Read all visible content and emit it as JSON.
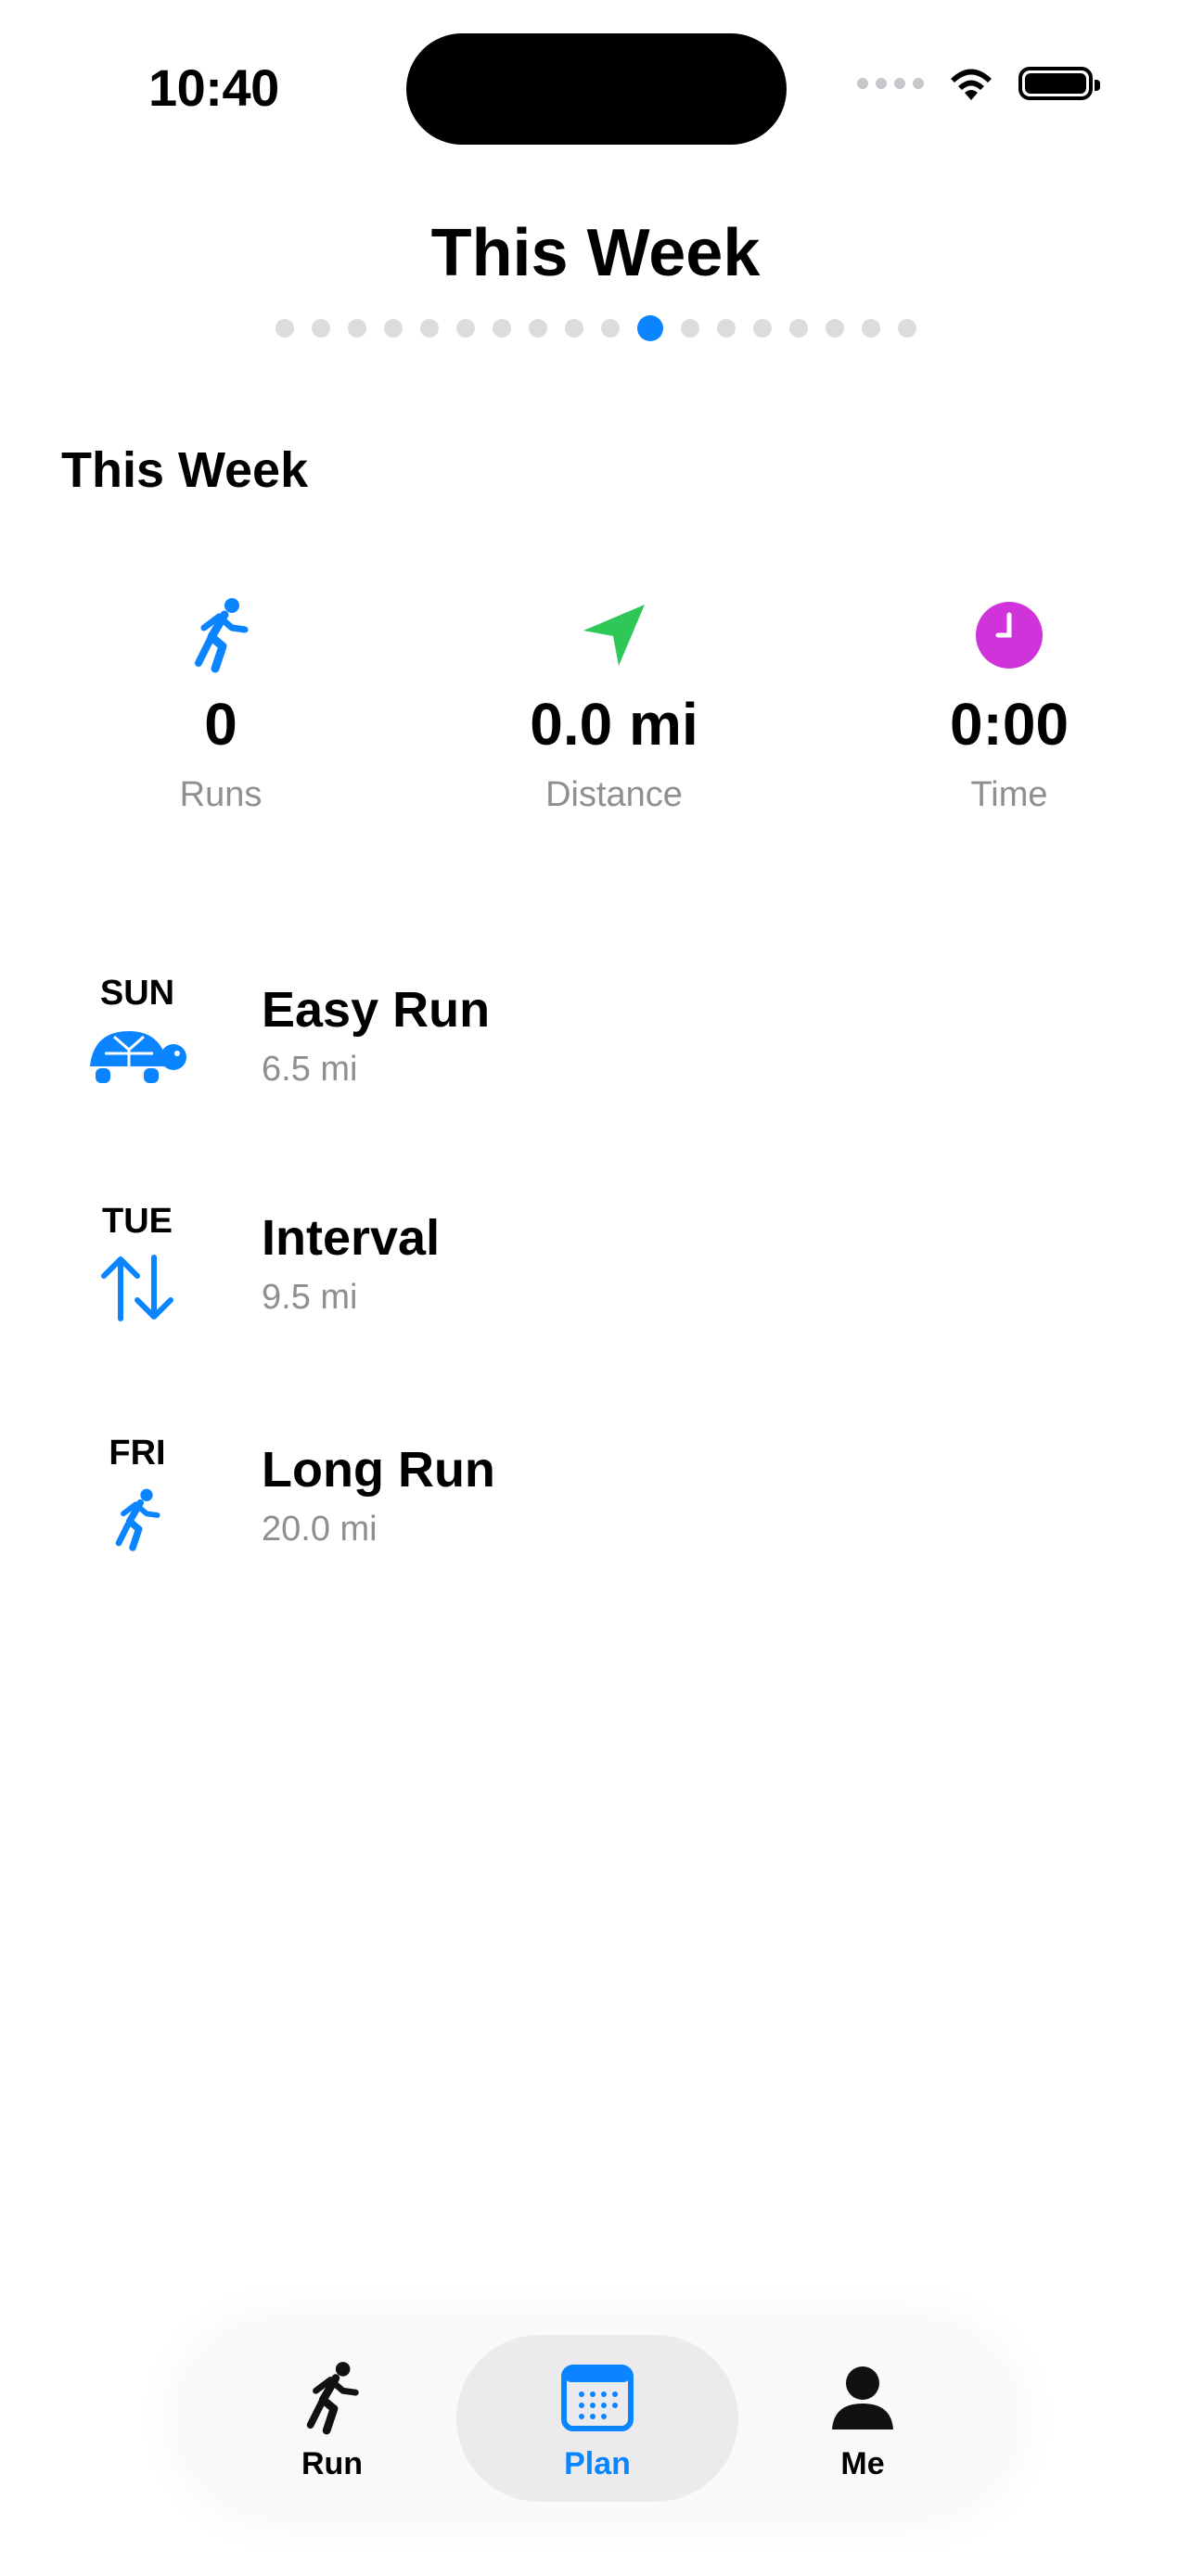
{
  "status_bar": {
    "time": "10:40"
  },
  "header": {
    "title": "This Week",
    "page_count": 18,
    "active_page_index": 10
  },
  "section": {
    "title": "This Week"
  },
  "stats": [
    {
      "icon": "running-figure-icon",
      "value": "0",
      "label": "Runs",
      "color": "#0a84ff"
    },
    {
      "icon": "location-arrow-icon",
      "value": "0.0 mi",
      "label": "Distance",
      "color": "#30c759"
    },
    {
      "icon": "clock-icon",
      "value": "0:00",
      "label": "Time",
      "color": "#d033d9"
    }
  ],
  "workouts": [
    {
      "day": "SUN",
      "icon": "tortoise-icon",
      "name": "Easy Run",
      "distance": "6.5 mi"
    },
    {
      "day": "TUE",
      "icon": "up-down-arrows-icon",
      "name": "Interval",
      "distance": "9.5 mi"
    },
    {
      "day": "FRI",
      "icon": "running-figure-icon",
      "name": "Long Run",
      "distance": "20.0 mi"
    }
  ],
  "tabbar": {
    "tabs": [
      {
        "label": "Run",
        "icon": "running-figure-icon",
        "active": false
      },
      {
        "label": "Plan",
        "icon": "calendar-icon",
        "active": true
      },
      {
        "label": "Me",
        "icon": "person-icon",
        "active": false
      }
    ]
  },
  "colors": {
    "accent": "#0a84ff",
    "distance": "#30c759",
    "time": "#d033d9",
    "secondary_text": "#8e8e93"
  }
}
